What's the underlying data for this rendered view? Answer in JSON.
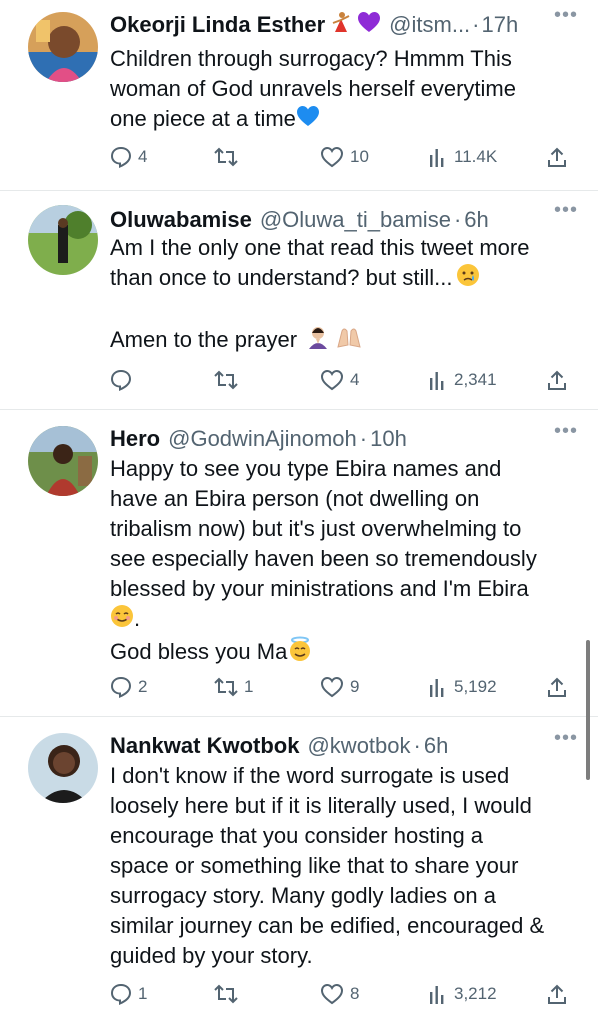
{
  "tweets": [
    {
      "name": "Okeorji Linda Esther",
      "handle": "@itsm...",
      "time": "17h",
      "lines": [
        "Children through surrogacy? Hmmm This",
        "woman of God unravels herself everytime",
        "one piece at a time"
      ],
      "replies": "4",
      "retweets": "",
      "likes": "10",
      "views": "11.4K"
    },
    {
      "name": "Oluwabamise",
      "handle": "@Oluwa_ti_bamise",
      "time": "6h",
      "lines": [
        "Am I the only one that read this tweet more",
        "than once to understand? but still..."
      ],
      "lines2": [
        "Amen to the prayer"
      ],
      "replies": "",
      "retweets": "",
      "likes": "4",
      "views": "2,341"
    },
    {
      "name": "Hero",
      "handle": "@GodwinAjinomoh",
      "time": "10h",
      "lines": [
        "Happy to see you type Ebira names and",
        "have an Ebira person (not dwelling on",
        "tribalism now) but it's just overwhelming to",
        "see especially haven been so tremendously",
        "blessed by your ministrations and I'm Ebira"
      ],
      "dot": ".",
      "lines2": [
        "God bless you Ma"
      ],
      "replies": "2",
      "retweets": "1",
      "likes": "9",
      "views": "5,192"
    },
    {
      "name": "Nankwat Kwotbok",
      "handle": "@kwotbok",
      "time": "6h",
      "lines": [
        "I don't know if the word surrogate is used",
        "loosely here but if it is literally used, I would",
        "encourage that you consider hosting a",
        "space or something like that to share your",
        "surrogacy story. Many godly ladies on a",
        "similar journey can be edified, encouraged &",
        "guided by your story."
      ],
      "replies": "1",
      "retweets": "",
      "likes": "8",
      "views": "3,212"
    }
  ],
  "separator": "·",
  "more_icon": "more-dots-icon",
  "colors": {
    "text": "#0f1419",
    "secondary": "#536471",
    "divider": "#e6e9ea",
    "heart": "#8e2bd6"
  }
}
